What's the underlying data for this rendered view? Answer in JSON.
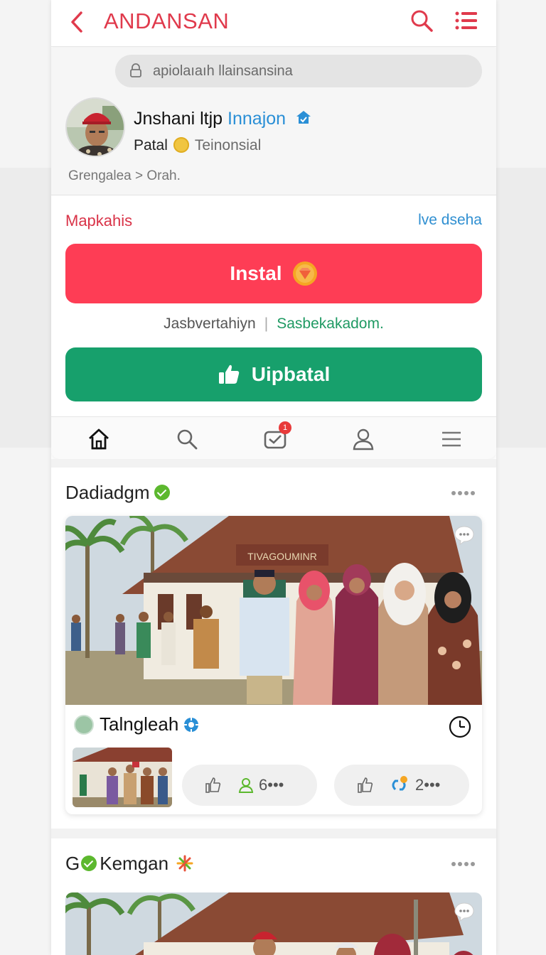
{
  "header": {
    "title": "ANDANSAN"
  },
  "profile": {
    "url": "apiolaıaıh llainsansina",
    "name": "Jnshani ltjp",
    "handle": "Innajon",
    "sub_left": "Patal",
    "sub_right": "Teinonsial",
    "breadcrumb": "Grengalea > Orah."
  },
  "install_card": {
    "left_label": "Mapkahis",
    "right_label": "lve dseha",
    "install_label": "Instal",
    "meta_left": "Jasbvertahiyn",
    "meta_sep": "|",
    "meta_right": "Sasbekakadom.",
    "update_label": "Uipbatal",
    "notification_badge": "1"
  },
  "posts": [
    {
      "author": "Dadiadgm",
      "photo_sign": "TIVAGOUMINR",
      "sub_author": "Talngleah",
      "likes_count": "6•••",
      "shares_count": "2•••"
    },
    {
      "author_prefix": "G",
      "author": "Kemgan"
    }
  ],
  "colors": {
    "accent_red": "#fe3d55",
    "accent_green": "#17a06c",
    "link_blue": "#2f8fd1"
  },
  "icons": [
    "back-icon",
    "search-icon",
    "list-icon",
    "lock-icon",
    "verified-icon",
    "coin-icon",
    "gem-icon",
    "thumb-icon",
    "home-icon",
    "search-nav-icon",
    "mail-icon",
    "user-icon",
    "menu-icon",
    "more-icon",
    "chat-icon",
    "gear-icon",
    "clock-icon",
    "like-icon",
    "user-green-icon",
    "share-icon",
    "sparkle-icon"
  ]
}
